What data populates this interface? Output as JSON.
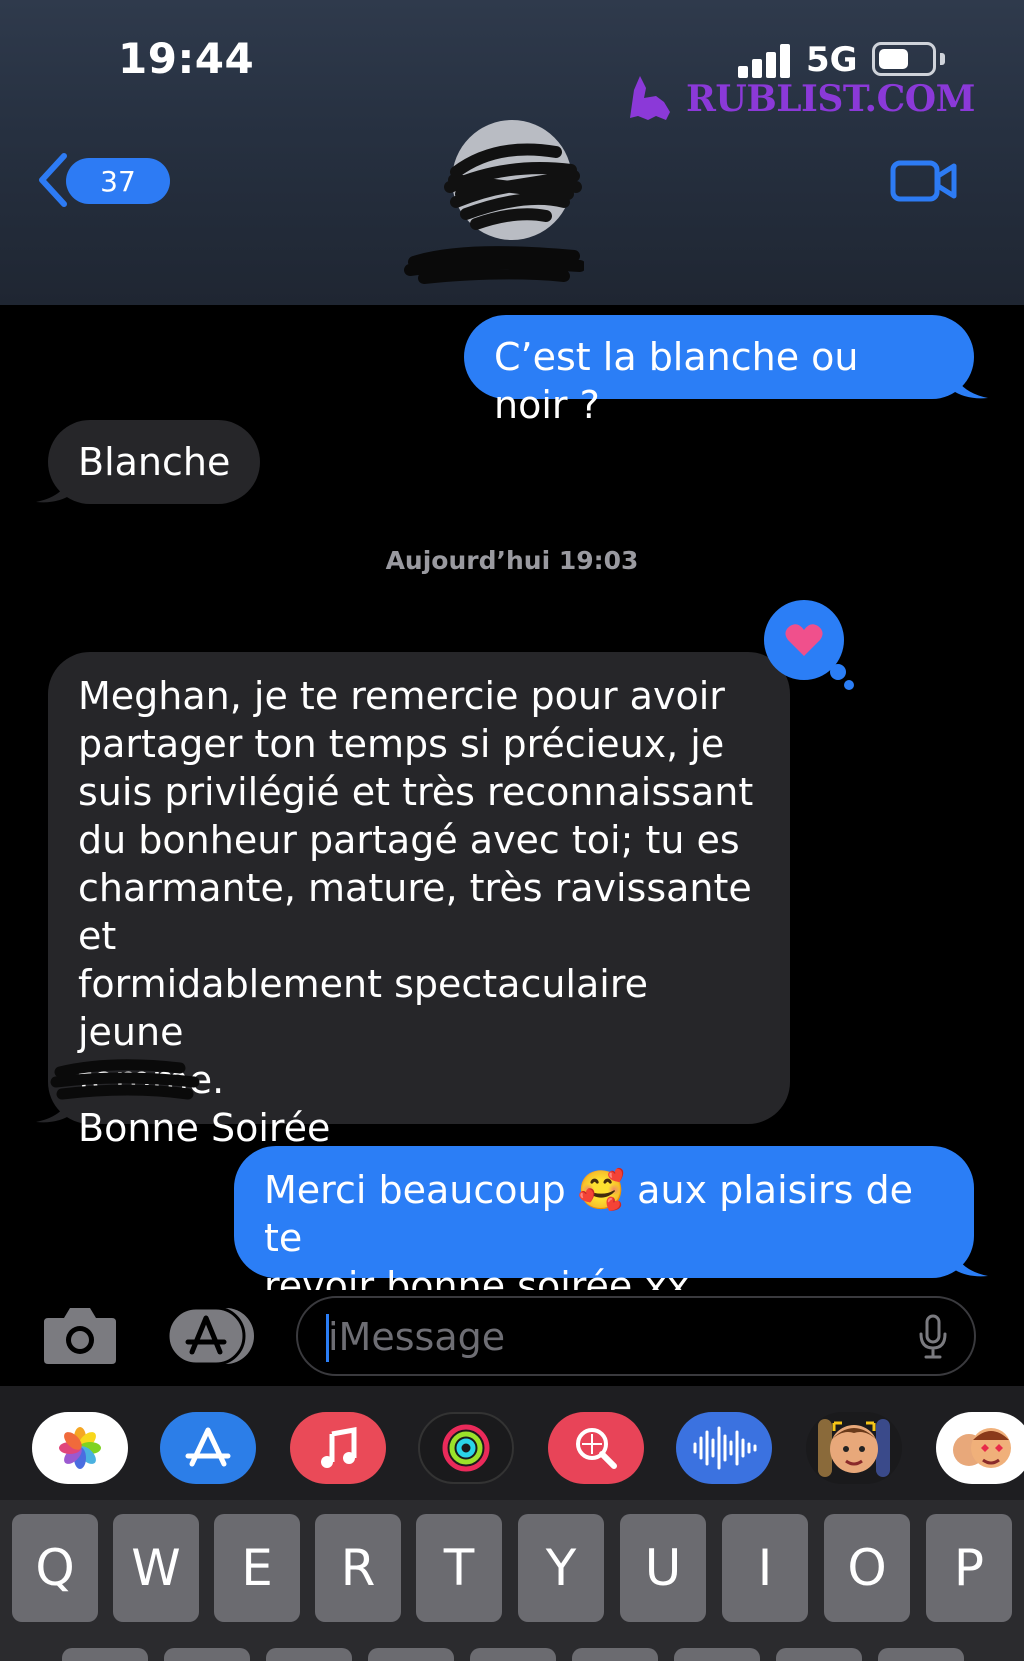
{
  "status_bar": {
    "time": "19:44",
    "network": "5G",
    "battery_level": 0.55
  },
  "watermark": "RUBLIST.COM",
  "nav": {
    "back_count": "37",
    "contact_name_redacted": true
  },
  "messages": [
    {
      "id": "m1",
      "direction": "outgoing",
      "text": "C’est la blanche ou noir ?"
    },
    {
      "id": "m2",
      "direction": "incoming",
      "text": "Blanche"
    },
    {
      "id": "m3",
      "direction": "incoming",
      "lines": [
        "Meghan,  je te remercie pour avoir",
        "partager ton temps si précieux, je",
        "suis privilégié et très reconnaissant",
        "du bonheur partagé avec toi;  tu es",
        "charmante, mature, très ravissante et",
        "formidablement spectaculaire jeune",
        "femme.",
        "Bonne Soirée"
      ],
      "tapback": "heart-icon"
    },
    {
      "id": "m4",
      "direction": "outgoing",
      "lines": [
        "Merci beaucoup 🥰 aux plaisirs de te",
        "revoir bonne soirée xx"
      ]
    }
  ],
  "timestamp": "Aujourd’hui 19:03",
  "composer": {
    "placeholder": "iMessage"
  },
  "app_drawer": [
    "photos-icon",
    "app-store-icon",
    "music-icon",
    "activity-icon",
    "image-search-icon",
    "audio-icon",
    "memoji-icon",
    "animoji-stickers-icon"
  ],
  "keyboard": {
    "row1": [
      "Q",
      "W",
      "E",
      "R",
      "T",
      "Y",
      "U",
      "I",
      "O",
      "P"
    ]
  },
  "colors": {
    "accent": "#2b7ef6",
    "incoming_bubble": "#262629",
    "header": "#263040",
    "watermark": "#8b39d8"
  }
}
